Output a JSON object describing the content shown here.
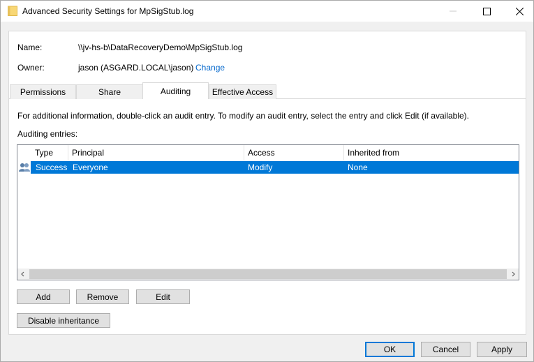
{
  "window": {
    "title": "Advanced Security Settings for MpSigStub.log"
  },
  "details": {
    "name_label": "Name:",
    "name_value": "\\\\jv-hs-b\\DataRecoveryDemo\\MpSigStub.log",
    "owner_label": "Owner:",
    "owner_value": "jason (ASGARD.LOCAL\\jason)",
    "change_link": "Change"
  },
  "tabs": [
    {
      "label": "Permissions",
      "active": false
    },
    {
      "label": "Share",
      "active": false
    },
    {
      "label": "Auditing",
      "active": true
    },
    {
      "label": "Effective Access",
      "active": false
    }
  ],
  "auditing": {
    "info_text": "For additional information, double-click an audit entry. To modify an audit entry, select the entry and click Edit (if available).",
    "entries_label": "Auditing entries:",
    "columns": [
      "Type",
      "Principal",
      "Access",
      "Inherited from"
    ],
    "rows": [
      {
        "type": "Success",
        "principal": "Everyone",
        "access": "Modify",
        "inherited": "None",
        "icon": "users-icon"
      }
    ]
  },
  "buttons": {
    "add": "Add",
    "remove": "Remove",
    "edit": "Edit",
    "disable_inheritance": "Disable inheritance",
    "ok": "OK",
    "cancel": "Cancel",
    "apply": "Apply"
  },
  "colors": {
    "selection": "#0078d7",
    "link": "#0066cc",
    "folder": "#f8d775"
  }
}
